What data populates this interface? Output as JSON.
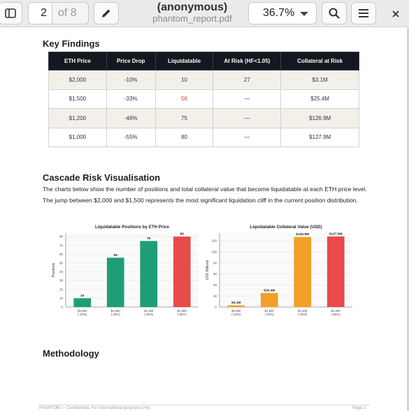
{
  "toolbar": {
    "page_current": "2",
    "page_total": "of 8",
    "title": "(anonymous)",
    "filename": "phantom_report.pdf",
    "zoom": "36.7%",
    "icons": [
      "sidebar-icon",
      "pencil-icon",
      "search-icon",
      "menu-icon",
      "close-icon"
    ]
  },
  "document": {
    "key_findings_heading": "Key Findings",
    "table": {
      "headers": [
        "ETH Price",
        "Price Drop",
        "Liquidatable",
        "At Risk (HF<1.05)",
        "Collateral at Risk"
      ],
      "rows": [
        [
          "$2,000",
          "-10%",
          "10",
          "27",
          "$3.1M"
        ],
        [
          "$1,500",
          "-33%",
          "56",
          "—",
          "$25.4M"
        ],
        [
          "$1,200",
          "-46%",
          "75",
          "—",
          "$126.9M"
        ],
        [
          "$1,000",
          "-55%",
          "80",
          "—",
          "$127.9M"
        ]
      ],
      "highlight_color": "#e03030"
    },
    "cascade_heading": "Cascade Risk Visualisation",
    "cascade_text": "The charts below show the number of positions and total collateral value that become liquidatable at each ETH price level. The jump between $2,000 and $1,500 represents the most significant liquidation cliff in the current position distribution.",
    "methodology_heading": "Methodology",
    "footer_left": "PHANTOM — Confidential. For informational purposes only.",
    "footer_right": "Page 2"
  },
  "chart_data": [
    {
      "type": "bar",
      "title": "Liquidatable Positions by ETH Price",
      "ylabel": "Positions",
      "xlabel": "",
      "categories": [
        "$2,000",
        "$1,500",
        "$1,200",
        "$1,000"
      ],
      "category_sublabels": [
        "(-10%)",
        "(-33%)",
        "(-46%)",
        "(-55%)"
      ],
      "values": [
        10,
        56,
        75,
        80
      ],
      "value_labels": [
        "10",
        "56",
        "75",
        "80"
      ],
      "bar_colors": [
        "#1e9e77",
        "#1e9e77",
        "#1e9e77",
        "#e84a4a"
      ],
      "ylim": [
        0,
        84
      ],
      "yticks": [
        0,
        10,
        20,
        30,
        40,
        50,
        60,
        70,
        80
      ],
      "grid": true
    },
    {
      "type": "bar",
      "title": "Liquidatable Collateral Value (USD)",
      "ylabel": "USD Millions",
      "xlabel": "",
      "categories": [
        "$2,000",
        "$1,500",
        "$1,200",
        "$1,000"
      ],
      "category_sublabels": [
        "(-10%)",
        "(-33%)",
        "(-46%)",
        "(-55%)"
      ],
      "values": [
        3.1,
        25.4,
        126.9,
        127.9
      ],
      "value_labels": [
        "$3.1M",
        "$25.4M",
        "$126.9M",
        "$127.9M"
      ],
      "bar_colors": [
        "#f2a02a",
        "#f2a02a",
        "#f2a02a",
        "#e84a4a"
      ],
      "ylim": [
        0,
        134
      ],
      "yticks": [
        0,
        20,
        40,
        60,
        80,
        100,
        120
      ],
      "grid": true
    }
  ]
}
